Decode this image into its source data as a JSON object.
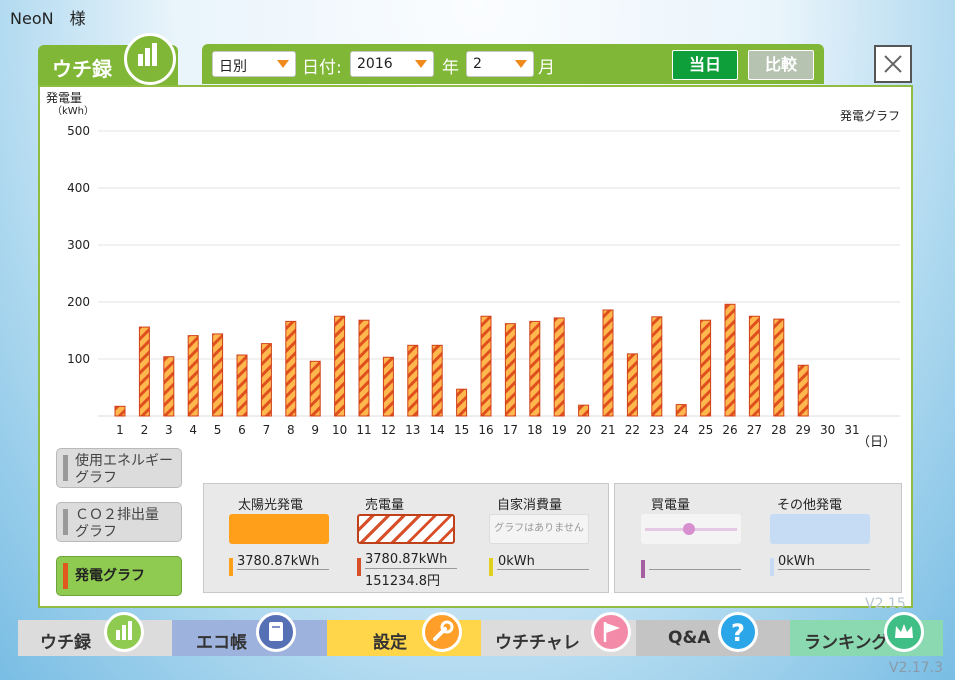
{
  "user": {
    "name": "NeoN　様"
  },
  "versions": {
    "inner": "V2.15",
    "outer": "V2.17.3"
  },
  "tab": {
    "label": "ウチ録"
  },
  "toolbar": {
    "mode": "日別",
    "date_label": "日付:",
    "year_value": "2016",
    "year_label": "年",
    "month_value": "2",
    "month_label": "月",
    "today_button": "当日",
    "compare_button": "比較"
  },
  "side_buttons": {
    "energy_line1": "使用エネルギー",
    "energy_line2": "グラフ",
    "co2_line1": "ＣＯ２排出量",
    "co2_line2": "グラフ",
    "generation": "発電グラフ"
  },
  "legend": {
    "solar": {
      "label": "太陽光発電",
      "value": "3780.87kWh"
    },
    "sold": {
      "label": "売電量",
      "value": "3780.87kWh",
      "amount": "151234.8円"
    },
    "self": {
      "label": "自家消費量",
      "note": "グラフはありません",
      "value": "0kWh"
    },
    "bought": {
      "label": "買電量"
    },
    "other": {
      "label": "その他発電",
      "value": "0kWh"
    }
  },
  "nav": [
    "ウチ録",
    "エコ帳",
    "設定",
    "ウチチャレ",
    "Q&A",
    "ランキング"
  ],
  "colors": {
    "accent_green": "#80b737",
    "bar_fill": "#ffb84d",
    "bar_stripe": "#e0501e",
    "today_green": "#0e9f3b"
  },
  "chart_data": {
    "type": "bar",
    "ylabel_line1": "発電量",
    "ylabel_line2": "（kWh）",
    "xlabel": "（日）",
    "title": "発電グラフ",
    "ylim": [
      0,
      500
    ],
    "yticks": [
      100,
      200,
      300,
      400,
      500
    ],
    "categories": [
      "1",
      "2",
      "3",
      "4",
      "5",
      "6",
      "7",
      "8",
      "9",
      "10",
      "11",
      "12",
      "13",
      "14",
      "15",
      "16",
      "17",
      "18",
      "19",
      "20",
      "21",
      "22",
      "23",
      "24",
      "25",
      "26",
      "27",
      "28",
      "29",
      "30",
      "31"
    ],
    "values": [
      17,
      156,
      104,
      141,
      144,
      107,
      127,
      166,
      96,
      175,
      168,
      103,
      124,
      124,
      47,
      175,
      162,
      166,
      172,
      19,
      186,
      109,
      174,
      20,
      168,
      196,
      175,
      170,
      89,
      0,
      0
    ]
  }
}
